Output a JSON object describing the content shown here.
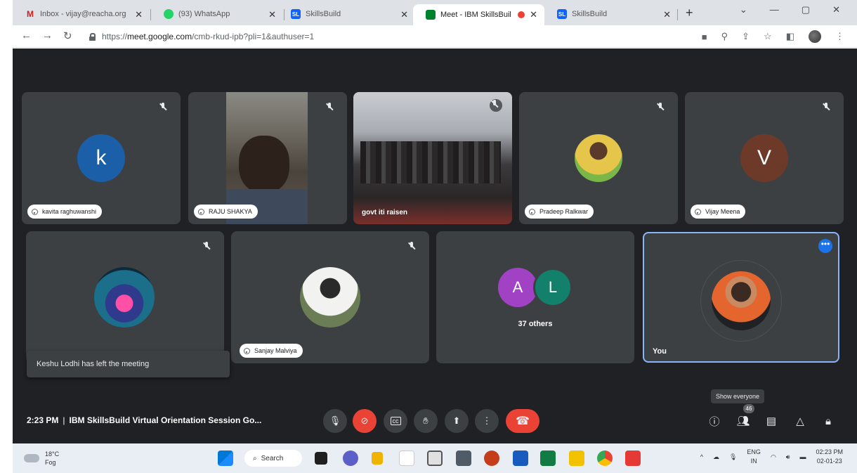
{
  "browser": {
    "tabs": [
      {
        "title": "Inbox - vijay@reacha.org",
        "icon": "gmail-icon",
        "color": "#c5221f"
      },
      {
        "title": "(93) WhatsApp",
        "icon": "whatsapp-icon",
        "color": "#25d366"
      },
      {
        "title": "SkillsBuild",
        "icon": "skillsbuild-icon",
        "color": "#0f62fe"
      },
      {
        "title": "Meet - IBM SkillsBuil",
        "icon": "meet-icon",
        "color": "#00832d"
      },
      {
        "title": "SkillsBuild",
        "icon": "skillsbuild-icon",
        "color": "#0f62fe"
      }
    ],
    "url_scheme": "https://",
    "url_host": "meet.google.com",
    "url_path": "/cmb-rkud-ipb?pli=1&authuser=1"
  },
  "participants": [
    {
      "name": "kavita raghuwanshi",
      "initial": "k",
      "color": "#1a5fa8"
    },
    {
      "name": "RAJU SHAKYA"
    },
    {
      "name": "govt iti raisen"
    },
    {
      "name": "Pradeep Ralkwar"
    },
    {
      "name": "Vijay Meena",
      "initial": "V",
      "color": "#6d3a2a"
    },
    {
      "name": "Sanjay Malviya"
    },
    {
      "others_initials": [
        "A",
        "L"
      ],
      "others_label": "37 others"
    },
    {
      "name": "You"
    }
  ],
  "accent_colors": {
    "red": "#ea4335",
    "blue": "#8ab4f8",
    "tile": "#3c4043",
    "bg": "#202124"
  },
  "notification": "Keshu Lodhi has left the meeting",
  "meeting": {
    "time": "2:23 PM",
    "separator": "|",
    "title": "IBM SkillsBuild Virtual Orientation Session Go..."
  },
  "right_controls": {
    "tooltip": "Show everyone",
    "participant_count": "46"
  },
  "taskbar": {
    "temperature": "18°C",
    "weather": "Fog",
    "search_label": "Search",
    "language": "ENG",
    "region": "IN",
    "time": "02:23 PM",
    "date": "02-01-23"
  }
}
